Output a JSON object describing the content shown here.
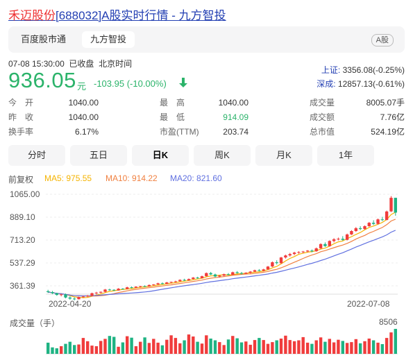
{
  "header": {
    "stock_name": "禾迈股份",
    "title_rest": "[688032]A股实时行情 - 九方智投"
  },
  "source_tabs": [
    "百度股市通",
    "九方智投"
  ],
  "market_badge": "A股",
  "quote": {
    "timestamp": "07-08 15:30:00",
    "status": "已收盘",
    "timezone": "北京时间",
    "price": "936.05",
    "unit": "元",
    "change": "-103.95 (-10.00%)"
  },
  "indices": [
    {
      "label": "上证:",
      "value": "3356.08(-0.25%)"
    },
    {
      "label": "深成:",
      "value": "12857.13(-0.61%)"
    }
  ],
  "stats": {
    "col1": [
      {
        "label": "今　开",
        "value": "1040.00"
      },
      {
        "label": "昨　收",
        "value": "1040.00"
      },
      {
        "label": "换手率",
        "value": "6.17%"
      }
    ],
    "col2": [
      {
        "label": "最　高",
        "value": "1040.00"
      },
      {
        "label": "最　低",
        "value": "914.09"
      },
      {
        "label": "市盈(TTM)",
        "value": "203.74"
      }
    ],
    "col3": [
      {
        "label": "成交量",
        "value": "8005.07手"
      },
      {
        "label": "成交额",
        "value": "7.76亿"
      },
      {
        "label": "总市值",
        "value": "524.19亿"
      }
    ]
  },
  "period_tabs": [
    "分时",
    "五日",
    "日K",
    "周K",
    "月K",
    "1年"
  ],
  "active_period": "日K",
  "adjust_label": "前复权",
  "ma_legend": {
    "ma5": "MA5: 975.55",
    "ma10": "MA10: 914.22",
    "ma20": "MA20: 821.60"
  },
  "colors": {
    "up": "#f03c3c",
    "down": "#1fb383",
    "ma5": "#f5b300",
    "ma10": "#f08040",
    "ma20": "#6070e0",
    "link": "#2440b3"
  },
  "volume_label": "成交量（手）",
  "volume_max_label": "8506",
  "chart_data": {
    "type": "candlestick",
    "y_ticks": [
      "1065.00",
      "889.10",
      "713.20",
      "537.29",
      "361.39"
    ],
    "ylim": [
      361.39,
      1065.0
    ],
    "x_ticks": [
      "2022-04-20",
      "2022-07-08"
    ],
    "ohlc": [
      [
        382,
        392,
        370,
        376
      ],
      [
        376,
        384,
        362,
        368
      ],
      [
        368,
        372,
        350,
        356
      ],
      [
        356,
        363,
        346,
        360
      ],
      [
        360,
        366,
        332,
        338
      ],
      [
        338,
        346,
        322,
        330
      ],
      [
        330,
        338,
        318,
        326
      ],
      [
        326,
        344,
        324,
        342
      ],
      [
        342,
        350,
        336,
        345
      ],
      [
        345,
        355,
        340,
        350
      ],
      [
        350,
        372,
        348,
        368
      ],
      [
        368,
        378,
        360,
        372
      ],
      [
        372,
        380,
        366,
        378
      ],
      [
        378,
        398,
        374,
        394
      ],
      [
        394,
        400,
        386,
        392
      ],
      [
        392,
        396,
        384,
        388
      ],
      [
        388,
        404,
        386,
        400
      ],
      [
        400,
        404,
        394,
        398
      ],
      [
        398,
        414,
        396,
        410
      ],
      [
        410,
        416,
        402,
        406
      ],
      [
        406,
        418,
        404,
        414
      ],
      [
        414,
        420,
        408,
        418
      ],
      [
        418,
        424,
        412,
        416
      ],
      [
        416,
        430,
        414,
        426
      ],
      [
        426,
        432,
        420,
        430
      ],
      [
        430,
        442,
        426,
        438
      ],
      [
        438,
        444,
        430,
        434
      ],
      [
        434,
        448,
        432,
        444
      ],
      [
        444,
        450,
        438,
        448
      ],
      [
        448,
        456,
        442,
        452
      ],
      [
        452,
        466,
        450,
        462
      ],
      [
        462,
        470,
        454,
        458
      ],
      [
        458,
        472,
        456,
        468
      ],
      [
        468,
        482,
        466,
        478
      ],
      [
        478,
        484,
        470,
        474
      ],
      [
        474,
        492,
        472,
        488
      ],
      [
        488,
        514,
        486,
        510
      ],
      [
        510,
        518,
        496,
        500
      ],
      [
        500,
        506,
        480,
        486
      ],
      [
        486,
        496,
        478,
        492
      ],
      [
        492,
        506,
        488,
        502
      ],
      [
        502,
        510,
        494,
        498
      ],
      [
        498,
        520,
        496,
        516
      ],
      [
        516,
        524,
        506,
        510
      ],
      [
        510,
        518,
        500,
        506
      ],
      [
        506,
        516,
        502,
        512
      ],
      [
        512,
        524,
        506,
        520
      ],
      [
        520,
        534,
        516,
        530
      ],
      [
        530,
        538,
        522,
        526
      ],
      [
        526,
        540,
        522,
        536
      ],
      [
        536,
        560,
        532,
        556
      ],
      [
        556,
        592,
        552,
        586
      ],
      [
        586,
        600,
        570,
        580
      ],
      [
        580,
        624,
        576,
        620
      ],
      [
        620,
        640,
        612,
        634
      ],
      [
        634,
        652,
        626,
        644
      ],
      [
        644,
        660,
        636,
        654
      ],
      [
        654,
        664,
        646,
        658
      ],
      [
        658,
        666,
        650,
        662
      ],
      [
        662,
        672,
        656,
        668
      ],
      [
        668,
        676,
        656,
        664
      ],
      [
        664,
        690,
        660,
        684
      ],
      [
        684,
        720,
        680,
        714
      ],
      [
        714,
        726,
        694,
        700
      ],
      [
        700,
        740,
        696,
        736
      ],
      [
        736,
        756,
        726,
        748
      ],
      [
        748,
        760,
        740,
        752
      ],
      [
        752,
        770,
        738,
        744
      ],
      [
        744,
        788,
        740,
        782
      ],
      [
        782,
        812,
        778,
        806
      ],
      [
        806,
        834,
        800,
        826
      ],
      [
        826,
        840,
        812,
        820
      ],
      [
        820,
        846,
        816,
        840
      ],
      [
        840,
        870,
        836,
        864
      ],
      [
        864,
        882,
        848,
        856
      ],
      [
        856,
        894,
        852,
        888
      ],
      [
        888,
        906,
        876,
        884
      ],
      [
        884,
        950,
        882,
        944
      ],
      [
        944,
        1052,
        940,
        1040
      ],
      [
        1040,
        1040,
        914,
        936
      ]
    ],
    "ma5_last": 975.55,
    "ma10_last": 914.22,
    "ma20_last": 821.6,
    "volume": [
      3800,
      2200,
      1900,
      2600,
      3400,
      4100,
      3000,
      3200,
      5400,
      4300,
      2800,
      2600,
      4400,
      5100,
      6100,
      5800,
      2400,
      3900,
      6000,
      5500,
      2600,
      4100,
      5600,
      3700,
      5100,
      3800,
      2900,
      4800,
      6300,
      5400,
      3600,
      4600,
      6600,
      5900,
      4100,
      3500,
      6300,
      5200,
      4600,
      4000,
      3000,
      4900,
      6100,
      5300,
      3900,
      4200,
      3100,
      4700,
      5400,
      4700,
      3400,
      4000,
      4600,
      5200,
      6200,
      4700,
      4300,
      4600,
      5700,
      3800,
      3400,
      4600,
      5600,
      4100,
      5100,
      3900,
      4800,
      4400,
      3700,
      4000,
      5000,
      3600,
      4300,
      5200,
      4600,
      3800,
      3300,
      5400,
      7300,
      8506
    ]
  }
}
